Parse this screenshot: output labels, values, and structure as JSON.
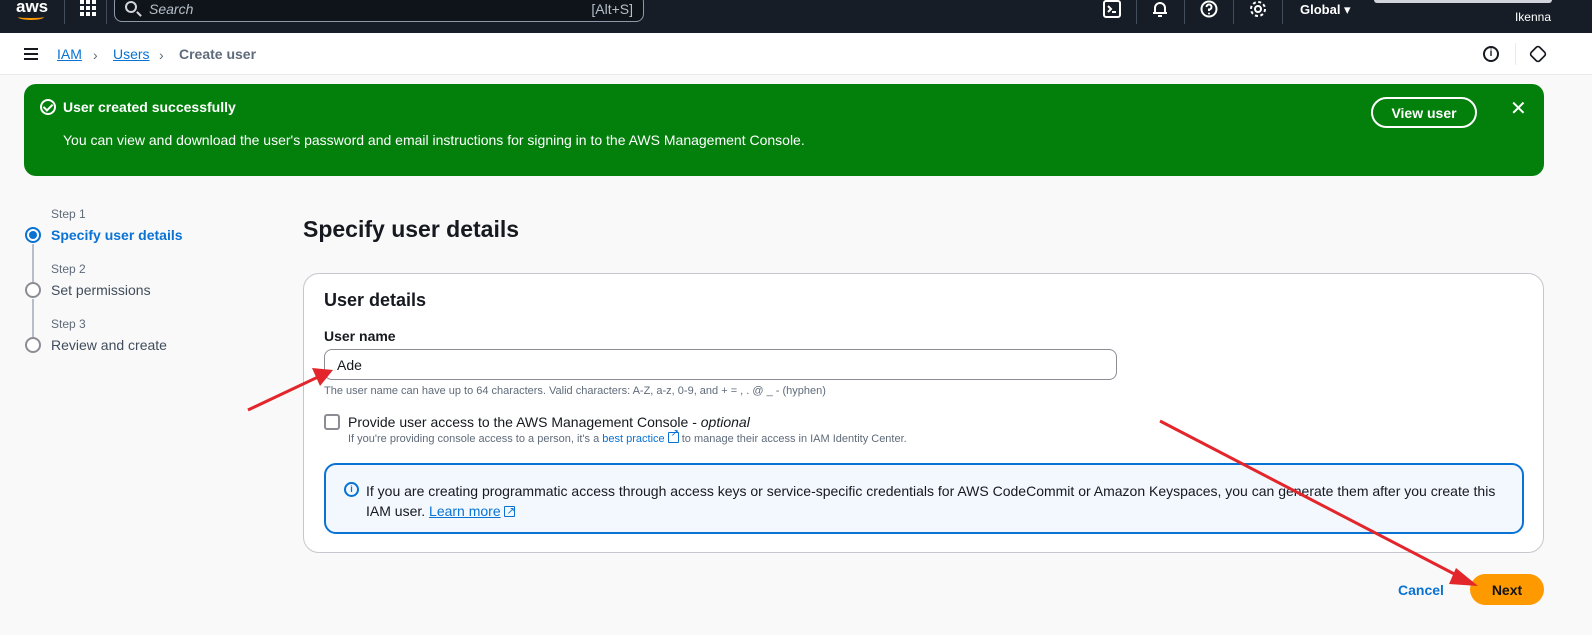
{
  "topbar": {
    "logo": "aws",
    "search_placeholder": "Search",
    "search_shortcut": "[Alt+S]",
    "region": "Global ▾",
    "user": "Ikenna"
  },
  "breadcrumb": {
    "items": [
      "IAM",
      "Users",
      "Create user"
    ]
  },
  "flash": {
    "title": "User created successfully",
    "message": "You can view and download the user's password and email instructions for signing in to the AWS Management Console.",
    "view_button": "View user",
    "close": "✕"
  },
  "wizard": {
    "steps": [
      {
        "label": "Step 1",
        "name": "Specify user details",
        "active": true
      },
      {
        "label": "Step 2",
        "name": "Set permissions",
        "active": false
      },
      {
        "label": "Step 3",
        "name": "Review and create",
        "active": false
      }
    ]
  },
  "page": {
    "title": "Specify user details"
  },
  "card": {
    "title": "User details",
    "username_label": "User name",
    "username_value": "Ade",
    "username_hint": "The user name can have up to 64 characters. Valid characters: A-Z, a-z, 0-9, and + = , . @ _ - (hyphen)",
    "console_checkbox_label": "Provide user access to the AWS Management Console - ",
    "console_checkbox_optional": "optional",
    "console_sub_prefix": "If you're providing console access to a person, it's a ",
    "console_sub_link": "best practice",
    "console_sub_suffix": " to manage their access in IAM Identity Center.",
    "info_text": "If you are creating programmatic access through access keys or service-specific credentials for AWS CodeCommit or Amazon Keyspaces, you can generate them after you create this IAM user. ",
    "info_link": "Learn more"
  },
  "footer": {
    "cancel": "Cancel",
    "next": "Next"
  },
  "colors": {
    "success": "#037f0c",
    "link": "#0972d3",
    "primary_button": "#ff9900",
    "annotation_arrow": "#e3262b"
  }
}
